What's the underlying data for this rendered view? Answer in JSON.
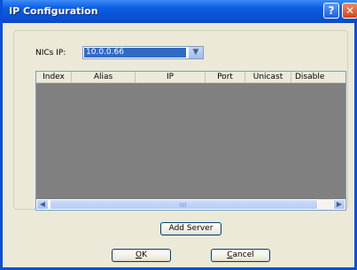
{
  "window": {
    "title": "IP Configuration",
    "help_label": "?",
    "close_label": "✕"
  },
  "nics": {
    "label": "NICs IP:",
    "value": "10.0.0.66",
    "arrow_icon": "chevron-down-icon"
  },
  "table": {
    "columns": [
      "Index",
      "Alias",
      "IP",
      "Port",
      "Unicast",
      "Disable"
    ],
    "rows": []
  },
  "scrollbar": {
    "left_arrow": "◀",
    "right_arrow": "▶"
  },
  "buttons": {
    "add_server": "Add Server",
    "ok_mnemonic": "O",
    "ok_rest": "K",
    "cancel_mnemonic": "C",
    "cancel_rest": "ancel"
  }
}
